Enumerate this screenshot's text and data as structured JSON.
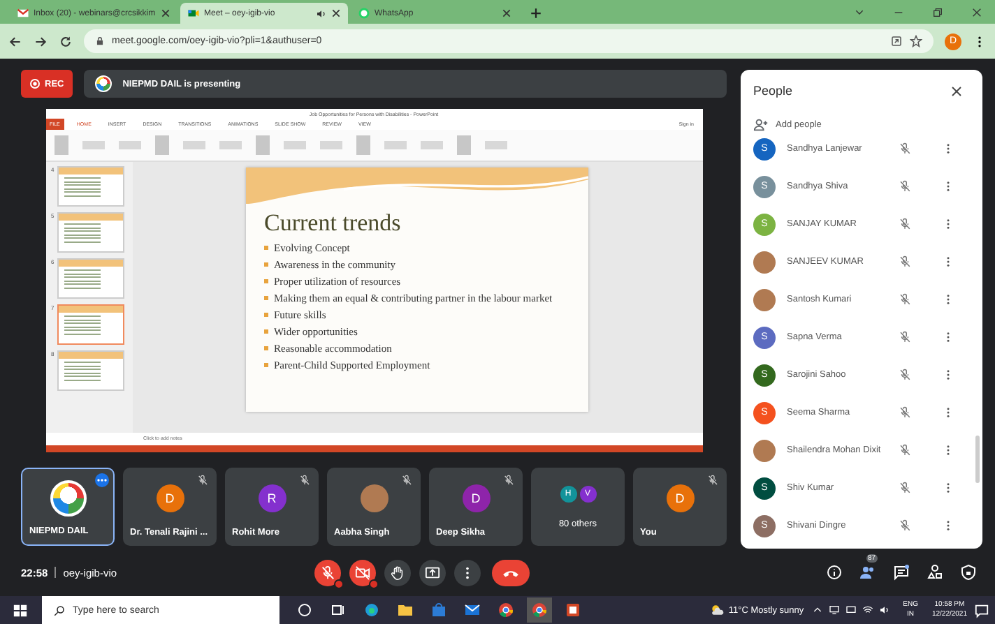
{
  "browser": {
    "tabs": [
      {
        "title": "Inbox (20) - webinars@crcsikkim",
        "selected": false,
        "playing_audio": false
      },
      {
        "title": "Meet – oey-igib-vio",
        "selected": true,
        "playing_audio": true
      },
      {
        "title": "WhatsApp",
        "selected": false,
        "playing_audio": false
      }
    ],
    "address": "meet.google.com/oey-igib-vio?pli=1&authuser=0",
    "profile": "D"
  },
  "meet": {
    "rec": "REC",
    "presenting": "NIEPMD DAIL is presenting",
    "presentation": {
      "window_title": "Job Opportunities for Persons with Disabilities - PowerPoint",
      "sign_in": "Sign in",
      "ribbon_tabs": [
        {
          "label": "FILE",
          "selected": false
        },
        {
          "label": "HOME",
          "selected": true
        },
        {
          "label": "INSERT",
          "selected": false
        },
        {
          "label": "DESIGN",
          "selected": false
        },
        {
          "label": "TRANSITIONS",
          "selected": false
        },
        {
          "label": "ANIMATIONS",
          "selected": false
        },
        {
          "label": "SLIDE SHOW",
          "selected": false
        },
        {
          "label": "REVIEW",
          "selected": false
        },
        {
          "label": "VIEW",
          "selected": false
        }
      ],
      "thumbnails": [
        {
          "number": "4",
          "selected": false
        },
        {
          "number": "5",
          "selected": false
        },
        {
          "number": "6",
          "selected": false
        },
        {
          "number": "7",
          "selected": true
        },
        {
          "number": "8",
          "selected": false
        }
      ],
      "slide": {
        "title": "Current trends",
        "bullets": [
          "Evolving Concept",
          "Awareness in the community",
          "Proper utilization of resources",
          "Making them an equal & contributing partner in the labour market",
          "Future skills",
          "Wider opportunities",
          "Reasonable accommodation",
          "Parent-Child Supported Employment"
        ]
      },
      "notes_placeholder": "Click to add notes"
    },
    "tiles": [
      {
        "name": "NIEPMD DAIL",
        "kind": "logo",
        "selected": true,
        "muted": false
      },
      {
        "name": "Dr. Tenali Rajini ...",
        "kind": "letter",
        "initial": "D",
        "color": "#e8710a",
        "selected": false,
        "muted": true
      },
      {
        "name": "Rohit More",
        "kind": "letter",
        "initial": "R",
        "color": "#8430ce",
        "selected": false,
        "muted": true
      },
      {
        "name": "Aabha Singh",
        "kind": "photo",
        "selected": false,
        "muted": true
      },
      {
        "name": "Deep Sikha",
        "kind": "letter",
        "initial": "D",
        "color": "#8e24aa",
        "selected": false,
        "muted": true
      },
      {
        "name": "80 others",
        "kind": "group",
        "members": [
          {
            "initial": "H",
            "color": "#12939a"
          },
          {
            "initial": "V",
            "color": "#8430ce"
          }
        ],
        "selected": false,
        "muted": false
      },
      {
        "name": "You",
        "kind": "letter",
        "initial": "D",
        "color": "#e8710a",
        "selected": false,
        "muted": true
      }
    ],
    "people": {
      "title": "People",
      "add": "Add people",
      "participants": [
        {
          "name": "Sandhya Lanjewar",
          "kind": "letter",
          "initial": "S",
          "color": "#1565c0"
        },
        {
          "name": "Sandhya Shiva",
          "kind": "letter",
          "initial": "S",
          "color": "#78909c"
        },
        {
          "name": "SANJAY KUMAR",
          "kind": "letter",
          "initial": "S",
          "color": "#7cb342"
        },
        {
          "name": "SANJEEV KUMAR",
          "kind": "photo"
        },
        {
          "name": "Santosh Kumari",
          "kind": "photo"
        },
        {
          "name": "Sapna Verma",
          "kind": "letter",
          "initial": "S",
          "color": "#5c6bc0"
        },
        {
          "name": "Sarojini Sahoo",
          "kind": "letter",
          "initial": "S",
          "color": "#33691e"
        },
        {
          "name": "Seema Sharma",
          "kind": "letter",
          "initial": "S",
          "color": "#f4511e"
        },
        {
          "name": "Shailendra Mohan Dixit",
          "kind": "photo"
        },
        {
          "name": "Shiv Kumar",
          "kind": "letter",
          "initial": "S",
          "color": "#004d40"
        },
        {
          "name": "Shivani Dingre",
          "kind": "letter",
          "initial": "S",
          "color": "#8d6e63"
        }
      ]
    },
    "call_bar": {
      "time": "22:58",
      "meeting_code": "oey-igib-vio",
      "mic_on": false,
      "camera_on": false,
      "participant_count": "87"
    }
  },
  "taskbar": {
    "search_placeholder": "Type here to search",
    "weather": "11°C Mostly sunny",
    "language": "ENG",
    "region": "IN",
    "time": "10:58 PM",
    "date": "12/22/2021"
  }
}
